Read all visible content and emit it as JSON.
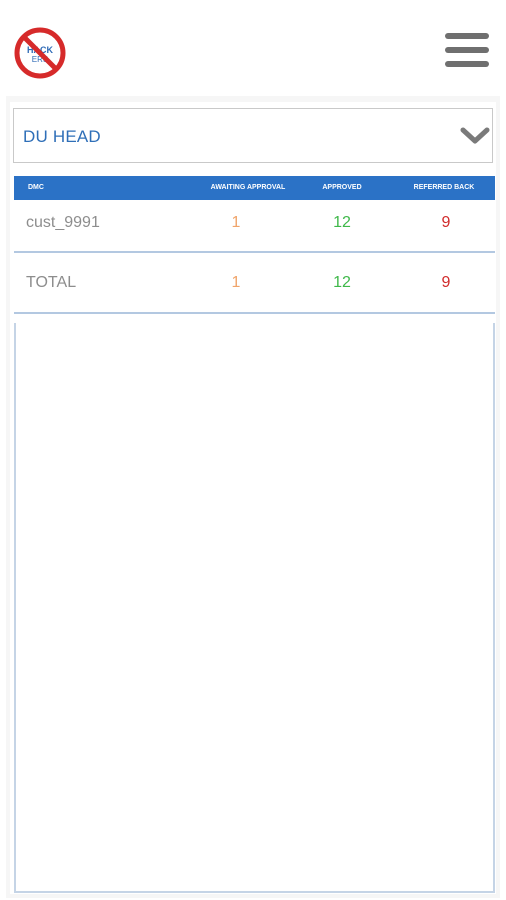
{
  "header": {
    "logo_icon": "no-hackers-logo-icon",
    "menu_icon": "hamburger-menu-icon"
  },
  "filter": {
    "selected": "DU HEAD",
    "chevron_icon": "chevron-down-icon"
  },
  "table": {
    "columns": [
      "DMC",
      "AWAITING APPROVAL",
      "APPROVED",
      "REFERRED BACK"
    ],
    "rows": [
      {
        "name": "cust_9991",
        "awaiting": "1",
        "approved": "12",
        "referred": "9"
      }
    ],
    "total": {
      "name": "TOTAL",
      "awaiting": "1",
      "approved": "12",
      "referred": "9"
    }
  },
  "colors": {
    "header_bg": "#2b72c6",
    "selected_text": "#2f6fb8",
    "awaiting": "#f0a46a",
    "approved": "#3fb84a",
    "referred": "#d12a2a"
  }
}
